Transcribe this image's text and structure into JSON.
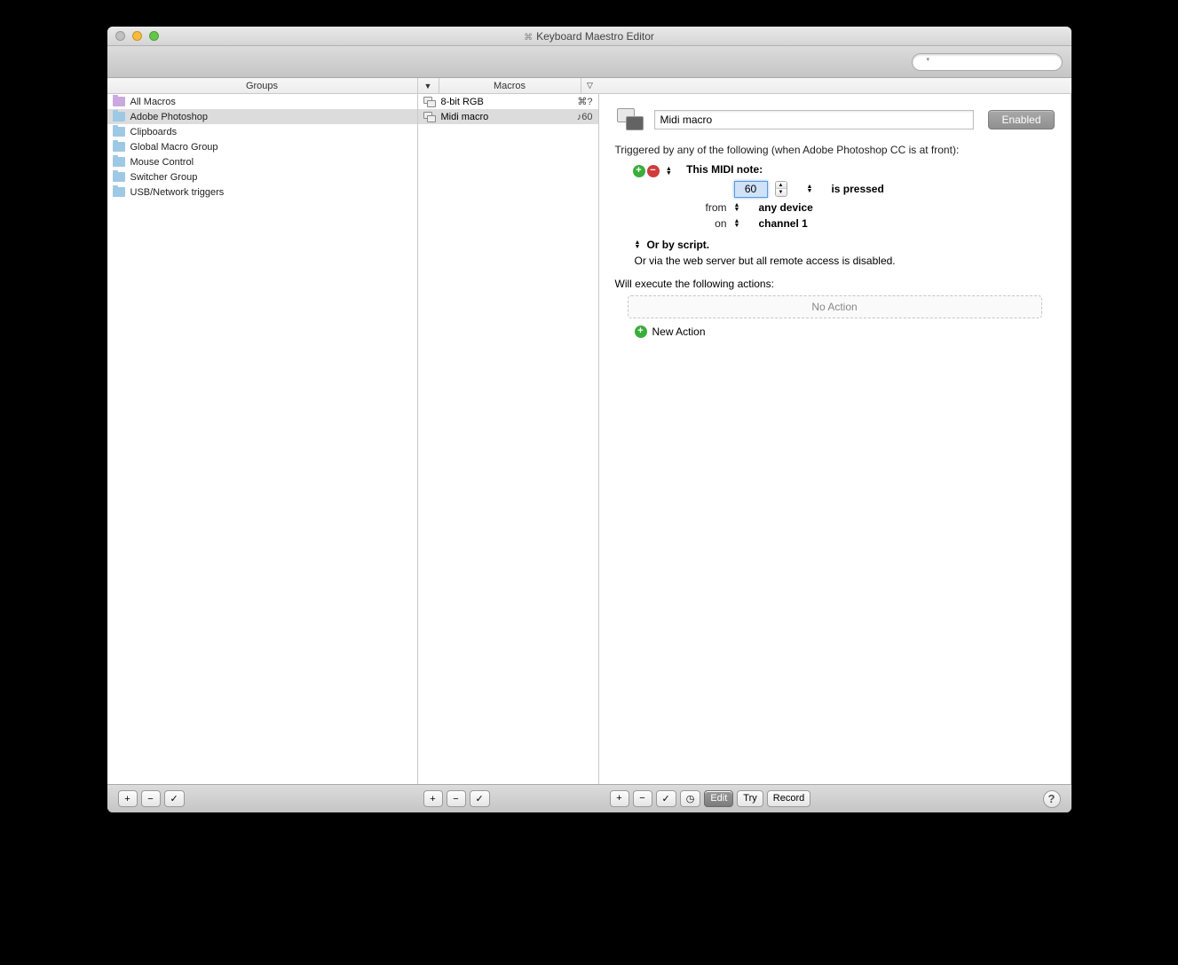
{
  "window": {
    "title": "Keyboard Maestro Editor"
  },
  "search": {
    "placeholder": ""
  },
  "columns": {
    "groups": "Groups",
    "macros": "Macros"
  },
  "groups": [
    {
      "label": "All Macros",
      "color": "purple"
    },
    {
      "label": "Adobe Photoshop",
      "selected": true
    },
    {
      "label": "Clipboards"
    },
    {
      "label": "Global Macro Group"
    },
    {
      "label": "Mouse Control"
    },
    {
      "label": "Switcher Group"
    },
    {
      "label": "USB/Network triggers"
    }
  ],
  "macros": [
    {
      "label": "8-bit RGB",
      "shortcut": "⌘?"
    },
    {
      "label": "Midi macro",
      "shortcut": "♪60",
      "selected": true
    }
  ],
  "detail": {
    "name": "Midi macro",
    "enabled_label": "Enabled",
    "trigger_intro": "Triggered by any of the following (when Adobe Photoshop CC is at front):",
    "trigger_type": "This MIDI note:",
    "note_value": "60",
    "note_action": "is pressed",
    "from_label": "from",
    "from_value": "any device",
    "on_label": "on",
    "on_value": "channel 1",
    "or_script": "Or by script.",
    "or_web": "Or via the web server but all remote access is disabled.",
    "exec_label": "Will execute the following actions:",
    "no_action": "No Action",
    "new_action": "New Action"
  },
  "statusbar": {
    "edit": "Edit",
    "try": "Try",
    "record": "Record"
  }
}
